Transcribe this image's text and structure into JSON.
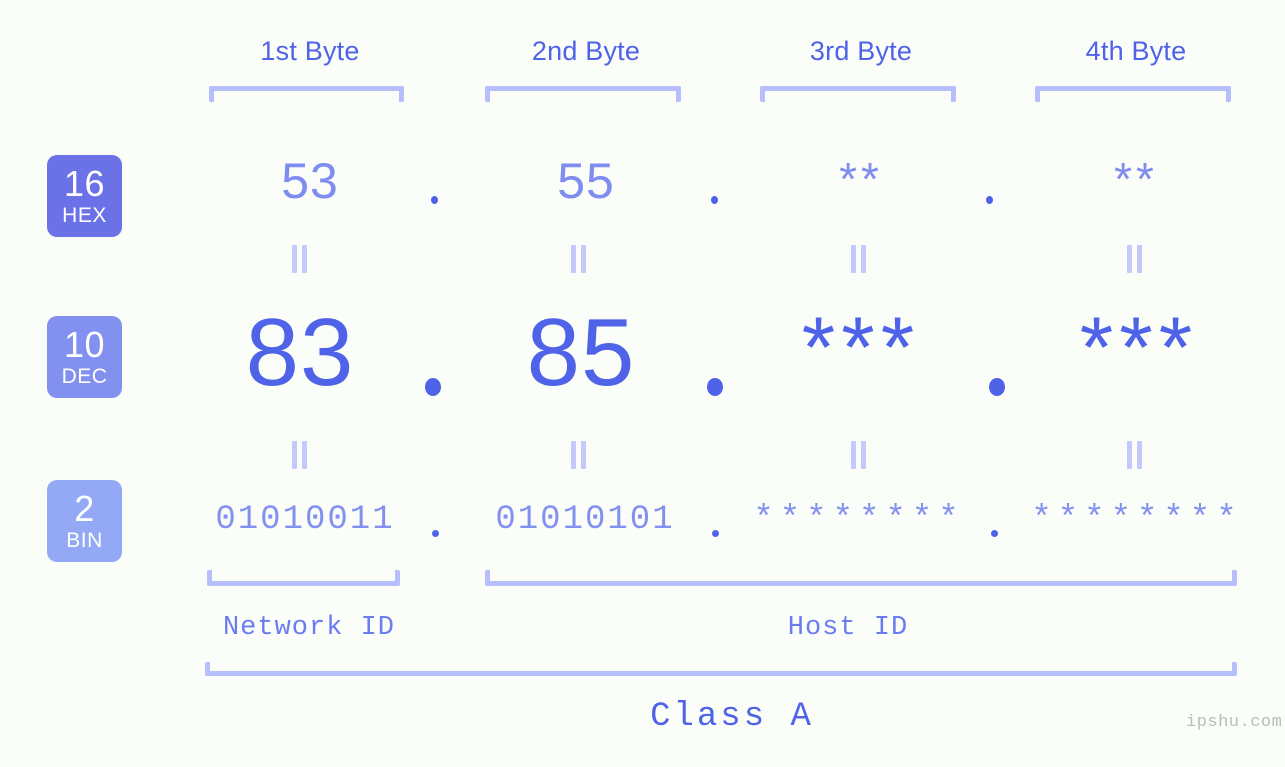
{
  "page": {
    "watermark": "ipshu.com"
  },
  "headers": [
    {
      "label": "1st Byte"
    },
    {
      "label": "2nd Byte"
    },
    {
      "label": "3rd Byte"
    },
    {
      "label": "4th Byte"
    }
  ],
  "bases": [
    {
      "number": "16",
      "abbr": "HEX",
      "color": "#6b72e8"
    },
    {
      "number": "10",
      "abbr": "DEC",
      "color": "#8290f0"
    },
    {
      "number": "2",
      "abbr": "BIN",
      "color": "#93a9f5"
    }
  ],
  "rows": {
    "hex": {
      "base_number": "16",
      "base_abbr": "HEX",
      "bytes": [
        "53",
        "55",
        "**",
        "**"
      ],
      "separator": "."
    },
    "dec": {
      "base_number": "10",
      "base_abbr": "DEC",
      "bytes": [
        "83",
        "85",
        "***",
        "***"
      ],
      "separator": "."
    },
    "bin": {
      "base_number": "2",
      "base_abbr": "BIN",
      "bytes": [
        "01010011",
        "01010101",
        "********",
        "********"
      ],
      "separator": "."
    }
  },
  "equality_symbol": "||",
  "segments": {
    "network_id": "Network ID",
    "host_id": "Host ID",
    "class": "Class A"
  },
  "colors": {
    "background": "#fbfdf8",
    "header_text": "#4f63e8",
    "bracket": "#b6bffb",
    "hex_value": "#7f8cf0",
    "dec_value": "#4f63e8",
    "bin_value": "#8290f0",
    "connector": "#c3caf9",
    "watermark": "#b9bcbe"
  }
}
